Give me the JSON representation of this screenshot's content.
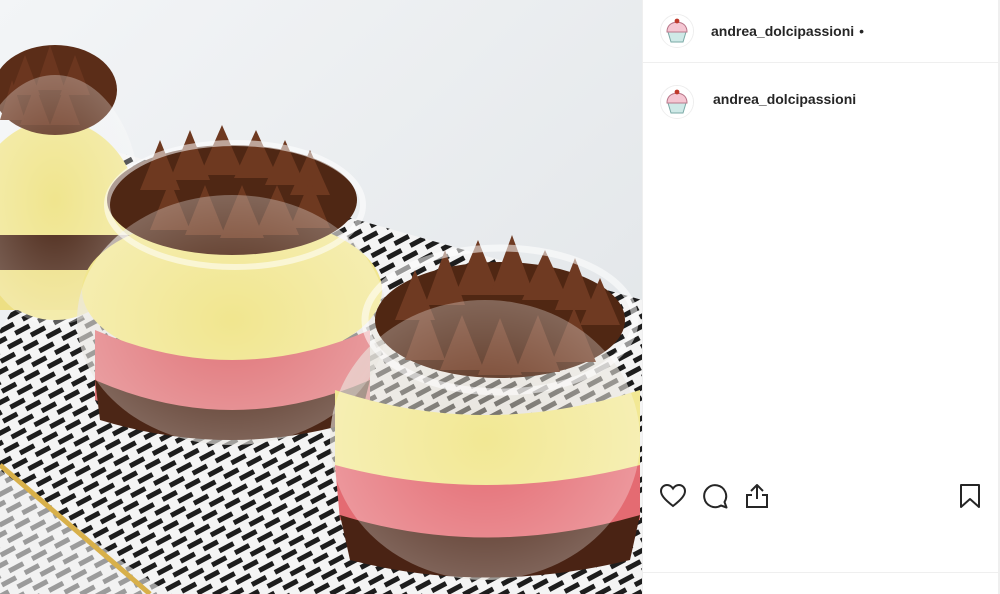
{
  "post": {
    "username": "andrea_dolcipassioni",
    "follow_separator": "•",
    "comment_username": "andrea_dolcipassioni"
  },
  "image": {
    "subject": "three glass jars of layered trifle dessert with chocolate piping on a patterned tray"
  },
  "actions": {
    "like": "heart-icon",
    "comment": "comment-icon",
    "share": "share-icon",
    "save": "bookmark-icon"
  },
  "colors": {
    "text": "#262626",
    "border": "#efefef",
    "chocolate": "#5a2e1c",
    "cream": "#efe38a",
    "sponge": "#e9787d"
  }
}
